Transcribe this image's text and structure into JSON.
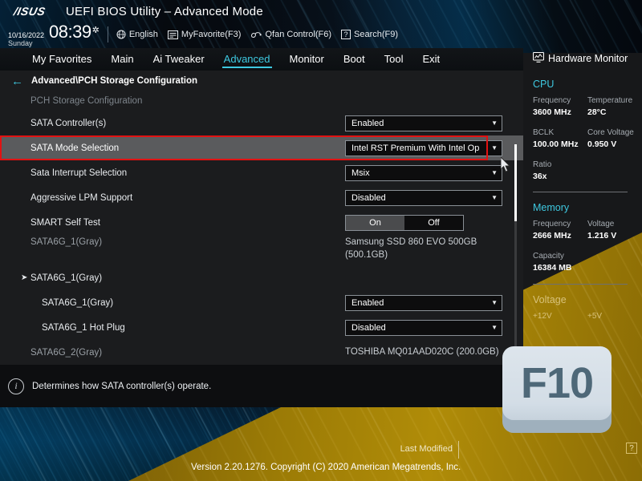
{
  "header": {
    "logo": "/ISUS",
    "title": "UEFI BIOS Utility – Advanced Mode",
    "date": "10/16/2022",
    "day": "Sunday",
    "time": "08:39",
    "gear_icon": "gear-icon",
    "items": [
      {
        "icon": "globe-icon",
        "label": "English"
      },
      {
        "icon": "myfavorite-icon",
        "label": "MyFavorite(F3)"
      },
      {
        "icon": "qfan-icon",
        "label": "Qfan Control(F6)"
      },
      {
        "icon": "search-icon",
        "label": "Search(F9)"
      }
    ]
  },
  "nav": {
    "tabs": [
      {
        "label": "My Favorites",
        "active": false
      },
      {
        "label": "Main",
        "active": false
      },
      {
        "label": "Ai Tweaker",
        "active": false
      },
      {
        "label": "Advanced",
        "active": true
      },
      {
        "label": "Monitor",
        "active": false
      },
      {
        "label": "Boot",
        "active": false
      },
      {
        "label": "Tool",
        "active": false
      },
      {
        "label": "Exit",
        "active": false
      }
    ]
  },
  "main": {
    "breadcrumb": "Advanced\\PCH Storage Configuration",
    "section_title": "PCH Storage Configuration",
    "rows": [
      {
        "label": "SATA Controller(s)",
        "type": "select",
        "value": "Enabled",
        "highlighted": false,
        "dim": false
      },
      {
        "label": "SATA Mode Selection",
        "type": "select",
        "value": "Intel RST Premium With Intel Op",
        "highlighted": true,
        "dim": false
      },
      {
        "label": "Sata Interrupt Selection",
        "type": "select",
        "value": "Msix",
        "highlighted": false,
        "dim": false
      },
      {
        "label": "Aggressive LPM Support",
        "type": "select",
        "value": "Disabled",
        "highlighted": false,
        "dim": false
      },
      {
        "label": "SMART Self Test",
        "type": "toggle",
        "on_label": "On",
        "off_label": "Off",
        "selected": "On",
        "highlighted": false,
        "dim": false
      },
      {
        "label": "SATA6G_1(Gray)",
        "type": "info",
        "value": "Samsung SSD 860 EVO 500GB (500.1GB)",
        "highlighted": false,
        "dim": true
      },
      {
        "label": "SATA6G_1(Gray)",
        "type": "submenu",
        "value": "",
        "highlighted": false,
        "dim": false
      },
      {
        "label": "SATA6G_1(Gray)",
        "type": "select",
        "value": "Enabled",
        "highlighted": false,
        "dim": false,
        "indent": true
      },
      {
        "label": "SATA6G_1 Hot Plug",
        "type": "select",
        "value": "Disabled",
        "highlighted": false,
        "dim": false,
        "indent": true
      },
      {
        "label": "SATA6G_2(Gray)",
        "type": "info",
        "value": "TOSHIBA MQ01AAD020C (200.0GB)",
        "highlighted": false,
        "dim": true
      }
    ],
    "submenu_arrow_icon": "chevron-right-icon"
  },
  "help": {
    "info_icon": "info-icon",
    "text": "Determines how SATA controller(s) operate."
  },
  "sidebar": {
    "title": "Hardware Monitor",
    "title_icon": "monitor-icon",
    "groups": [
      {
        "name": "CPU",
        "color": "#3ec8e0",
        "pairs": [
          [
            {
              "key": "Frequency",
              "value": "3600 MHz"
            },
            {
              "key": "Temperature",
              "value": "28°C"
            }
          ],
          [
            {
              "key": "BCLK",
              "value": "100.00 MHz"
            },
            {
              "key": "Core Voltage",
              "value": "0.950 V"
            }
          ],
          [
            {
              "key": "Ratio",
              "value": "36x"
            }
          ]
        ]
      },
      {
        "name": "Memory",
        "color": "#3ec8e0",
        "pairs": [
          [
            {
              "key": "Frequency",
              "value": "2666 MHz"
            },
            {
              "key": "Voltage",
              "value": "1.216 V"
            }
          ],
          [
            {
              "key": "Capacity",
              "value": "16384 MB"
            }
          ]
        ]
      },
      {
        "name": "Voltage",
        "color": "#d8c27a",
        "pairs": [
          [
            {
              "key": "+12V",
              "value": ""
            },
            {
              "key": "+5V",
              "value": ""
            }
          ]
        ]
      }
    ]
  },
  "overlay": {
    "key_label": "F10"
  },
  "footer": {
    "last_modified": "Last Modified",
    "version": "Version 2.20.1276. Copyright (C) 2020 American Megatrends, Inc.",
    "help_icon": "question-mark-icon"
  },
  "colors": {
    "accent": "#3ec8e0",
    "highlight_border": "#e21212",
    "gold": "#b08c08",
    "panel_bg": "#1b1c1e"
  }
}
